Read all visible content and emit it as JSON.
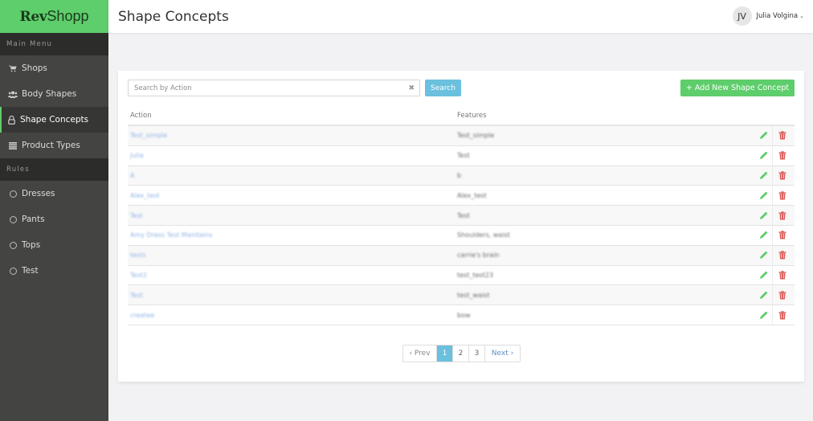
{
  "app": {
    "logo_bold": "Rev",
    "logo_light": "Shopp",
    "brand_color": "#5ecd6b"
  },
  "sidebar": {
    "main_menu_label": "Main Menu",
    "main_items": [
      {
        "label": "Shops",
        "icon": "shopping-cart-icon",
        "active": false
      },
      {
        "label": "Body Shapes",
        "icon": "users-icon",
        "active": false
      },
      {
        "label": "Shape Concepts",
        "icon": "lock-icon",
        "active": true
      },
      {
        "label": "Product Types",
        "icon": "list-icon",
        "active": false
      }
    ],
    "rules_label": "Rules",
    "rule_items": [
      {
        "label": "Dresses",
        "icon": "circle-icon"
      },
      {
        "label": "Pants",
        "icon": "circle-icon"
      },
      {
        "label": "Tops",
        "icon": "circle-icon"
      },
      {
        "label": "Test",
        "icon": "circle-icon"
      }
    ]
  },
  "header": {
    "title": "Shape Concepts",
    "user": {
      "initials": "JV",
      "name": "Julia Volgina"
    }
  },
  "toolbar": {
    "search_placeholder": "Search by Action",
    "search_value": "",
    "search_label": "Search",
    "add_label": "+ Add New Shape Concept"
  },
  "table": {
    "columns": [
      "Action",
      "Features"
    ],
    "rows": [
      {
        "action": "Test_simple",
        "features": "Test_simple"
      },
      {
        "action": "Julia",
        "features": "Test"
      },
      {
        "action": "A",
        "features": "b"
      },
      {
        "action": "Alex_test",
        "features": "Alex_test"
      },
      {
        "action": "Test",
        "features": "Test"
      },
      {
        "action": "Amy Dress Test Maintains",
        "features": "Shoulders, waist"
      },
      {
        "action": "tests",
        "features": "carrie's brain"
      },
      {
        "action": "Test2",
        "features": "test_test23"
      },
      {
        "action": "Test",
        "features": "test_waist"
      },
      {
        "action": "createe",
        "features": "bow"
      }
    ]
  },
  "pagination": {
    "prev_label": "‹ Prev",
    "pages": [
      "1",
      "2",
      "3"
    ],
    "current": "1",
    "next_label": "Next ›"
  },
  "colors": {
    "edit": "#5ecd6b",
    "delete": "#d9534f",
    "search_button": "#6bc0de"
  }
}
